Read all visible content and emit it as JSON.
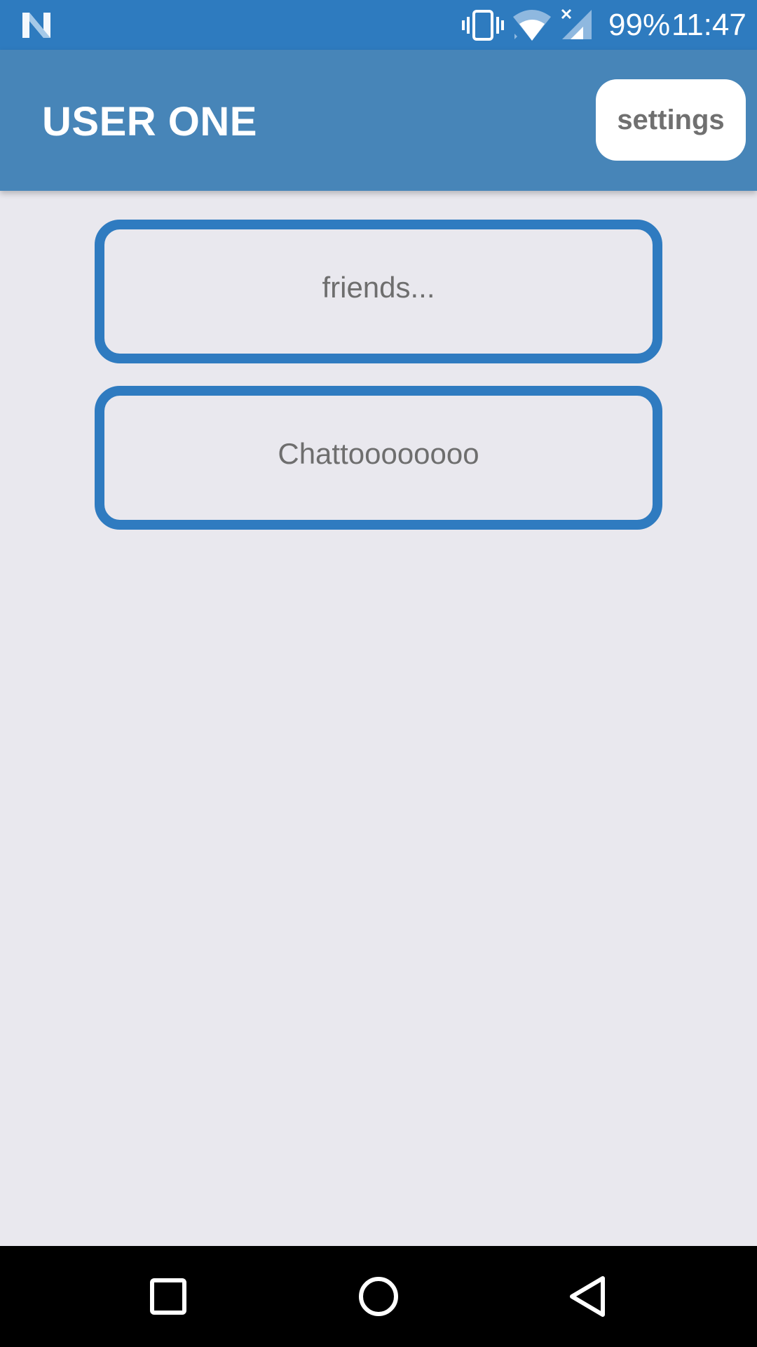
{
  "status_bar": {
    "battery": "99%",
    "time": "11:47",
    "icons": [
      "n-logo-icon",
      "vibrate-icon",
      "wifi-icon",
      "signal-icon"
    ]
  },
  "app_bar": {
    "title": "USER ONE",
    "settings_label": "settings"
  },
  "main": {
    "buttons": [
      {
        "label": "friends..."
      },
      {
        "label": "Chattoooooooo"
      }
    ]
  },
  "nav_bar": {
    "icons": [
      "recents-icon",
      "home-icon",
      "back-icon"
    ]
  },
  "colors": {
    "status_bar": "#2E7BBF",
    "app_bar": "#4785B8",
    "button_border": "#2F7BC0",
    "background": "#E9E8EE",
    "text_gray": "#6E6E6E"
  }
}
